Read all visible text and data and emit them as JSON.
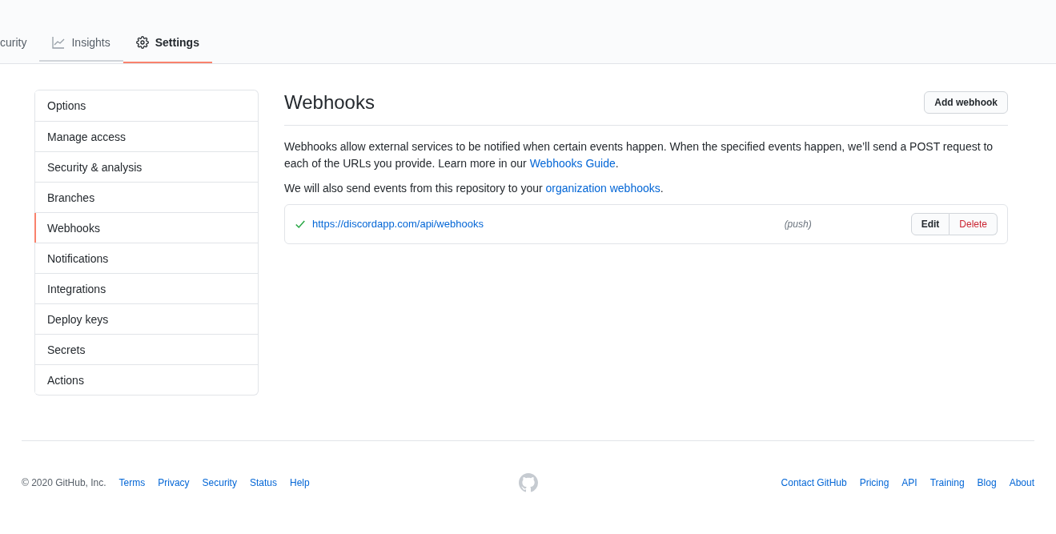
{
  "tabs": [
    {
      "label": "curity",
      "kind": "none",
      "selected": false,
      "hovered": false
    },
    {
      "label": "Insights",
      "kind": "graph",
      "selected": false,
      "hovered": true
    },
    {
      "label": "Settings",
      "kind": "gear",
      "selected": true,
      "hovered": false
    }
  ],
  "sidebar": {
    "items": [
      {
        "label": "Options",
        "selected": false
      },
      {
        "label": "Manage access",
        "selected": false
      },
      {
        "label": "Security & analysis",
        "selected": false
      },
      {
        "label": "Branches",
        "selected": false
      },
      {
        "label": "Webhooks",
        "selected": true
      },
      {
        "label": "Notifications",
        "selected": false
      },
      {
        "label": "Integrations",
        "selected": false
      },
      {
        "label": "Deploy keys",
        "selected": false
      },
      {
        "label": "Secrets",
        "selected": false
      },
      {
        "label": "Actions",
        "selected": false
      }
    ]
  },
  "main": {
    "title": "Webhooks",
    "add_button": "Add webhook",
    "description": {
      "before": "Webhooks allow external services to be notified when certain events happen. When the specified events happen, we’ll send a POST request to each of the URLs you provide. Learn more in our ",
      "link": "Webhooks Guide",
      "after": "."
    },
    "note": {
      "before": "We will also send events from this repository to your ",
      "link": "organization webhooks",
      "after": "."
    },
    "hooks": [
      {
        "url": "https://discordapp.com/api/webhooks",
        "events": "(push)",
        "ok": true,
        "edit": "Edit",
        "delete": "Delete"
      }
    ]
  },
  "footer": {
    "copyright": "© 2020 GitHub, Inc.",
    "left_links": [
      "Terms",
      "Privacy",
      "Security",
      "Status",
      "Help"
    ],
    "right_links": [
      "Contact GitHub",
      "Pricing",
      "API",
      "Training",
      "Blog",
      "About"
    ]
  }
}
